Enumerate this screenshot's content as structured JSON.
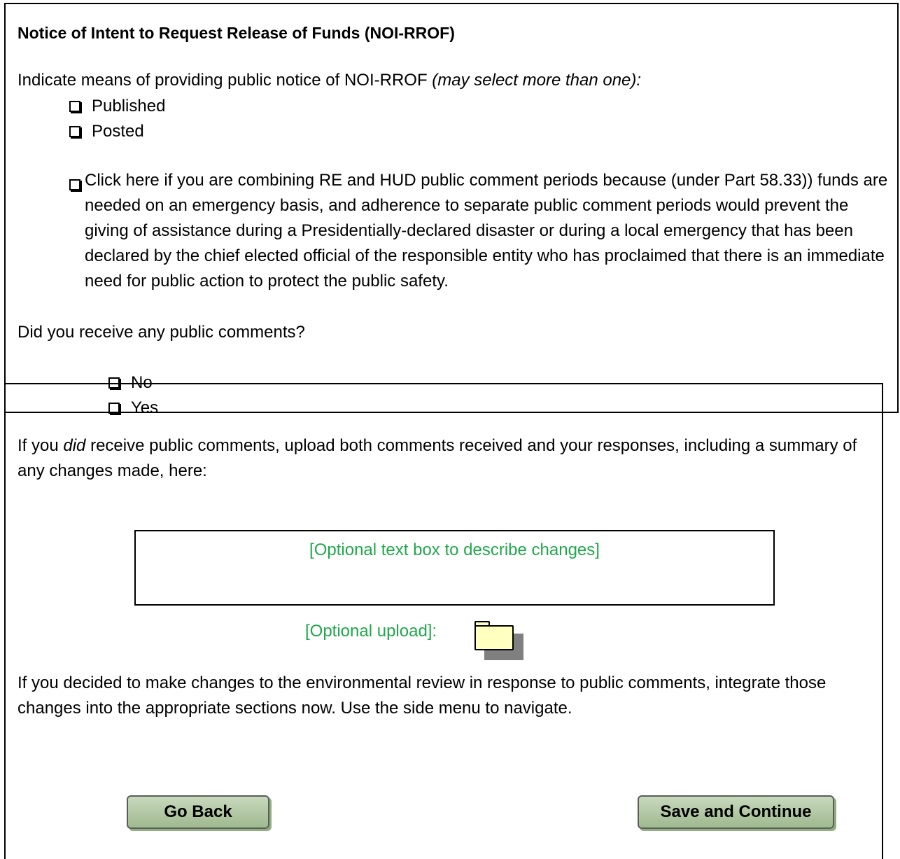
{
  "section": {
    "title": "Notice of Intent to Request Release of Funds (NOI-RROF)"
  },
  "notice_means": {
    "prompt": "Indicate means of providing public notice of NOI-RROF ",
    "prompt_note": "(may select more than one):",
    "options": [
      "Published",
      "Posted"
    ]
  },
  "emergency": {
    "label": "Click here if you are combining RE and HUD public comment periods because (under Part 58.33)) funds are needed on an emergency basis, and adherence to separate public comment periods would prevent the giving of assistance during a Presidentially-declared disaster or during a local emergency that has been declared by the chief elected official of the responsible entity who has proclaimed that there is an immediate need for public action to protect the public safety."
  },
  "comments": {
    "question": "Did you receive any public comments?",
    "options": [
      "No",
      "Yes"
    ]
  },
  "upload_instructions": {
    "prefix": "If you ",
    "emphasis": "did",
    "suffix": " receive public comments, upload both comments received and your responses, including a summary of any changes made, here:"
  },
  "changes_textbox": {
    "placeholder": "[Optional text box to describe changes]"
  },
  "upload": {
    "label": "[Optional upload]:",
    "icon": "folder-icon"
  },
  "integration_note": "If you decided to make changes to the environmental review in response to public comments, integrate those changes into the appropriate sections now. Use the side menu to navigate.",
  "buttons": {
    "back": "Go Back",
    "save": "Save and Continue"
  },
  "colors": {
    "placeholder_text": "#1fa84a",
    "button_fill": "#b3c9a6",
    "folder_fill": "#ffffc0"
  }
}
